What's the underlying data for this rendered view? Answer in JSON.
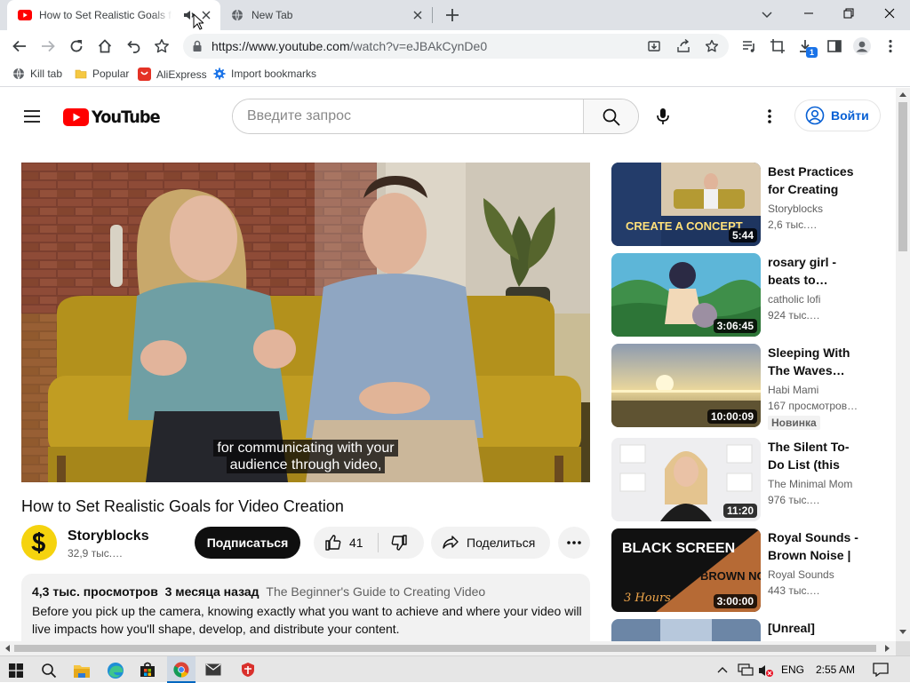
{
  "browser": {
    "tabs": [
      {
        "title": "How to Set Realistic Goals for Video Creation",
        "active": true
      },
      {
        "title": "New Tab",
        "active": false
      }
    ],
    "url_host": "https://www.youtube.com",
    "url_path": "/watch?v=eJBAkCynDe0",
    "bookmarks": [
      "Kill tab",
      "Popular",
      "AliExpress",
      "Import bookmarks"
    ],
    "download_badge": "1"
  },
  "youtube": {
    "logo_text": "YouTube",
    "search_placeholder": "Введите запрос",
    "signin_label": "Войти",
    "video": {
      "subtitle_line1": "for communicating with your",
      "subtitle_line2": "audience through video,",
      "title": "How to Set Realistic Goals for Video Creation",
      "channel": "Storyblocks",
      "subscribers": "32,9 тыс.…",
      "subscribe_label": "Подписаться",
      "likes": "41",
      "share_label": "Поделиться",
      "views": "4,3 тыс. просмотров",
      "date": "3 месяца назад",
      "tag": "The Beginner's Guide to Creating Video",
      "description": "Before you pick up the camera, knowing exactly what you want to achieve and where your video will live impacts how you'll shape, develop, and distribute your content."
    },
    "related": [
      {
        "title": "Best Practices for Creating a…",
        "channel": "Storyblocks",
        "views": "2,6 тыс.…",
        "duration": "5:44",
        "thumb_text": "CREATE A CONCEPT"
      },
      {
        "title": "rosary girl - beats to…",
        "channel": "catholic lofi",
        "views": "924 тыс.…",
        "duration": "3:06:45"
      },
      {
        "title": "Sleeping With The Waves…",
        "channel": "Habi Mami",
        "views": "167 просмотров…",
        "duration": "10:00:09",
        "badge": "Новинка"
      },
      {
        "title": "The Silent To-Do List (this is…",
        "channel": "The Minimal Mom",
        "views": "976 тыс.…",
        "duration": "11:20"
      },
      {
        "title": "Royal Sounds - Brown Noise | …",
        "channel": "Royal Sounds",
        "views": "443 тыс.…",
        "duration": "3:00:00",
        "thumb_text_1": "BLACK SCREEN",
        "thumb_text_2": "BROWN NOISE",
        "thumb_text_3": "3 Hours"
      },
      {
        "title": "[Unreal]"
      }
    ]
  },
  "taskbar": {
    "lang": "ENG",
    "time": "2:55 AM"
  },
  "colors": {
    "yt_red": "#ff0000",
    "link_blue": "#065fd4",
    "chrome_tabstrip": "#dee1e6"
  }
}
